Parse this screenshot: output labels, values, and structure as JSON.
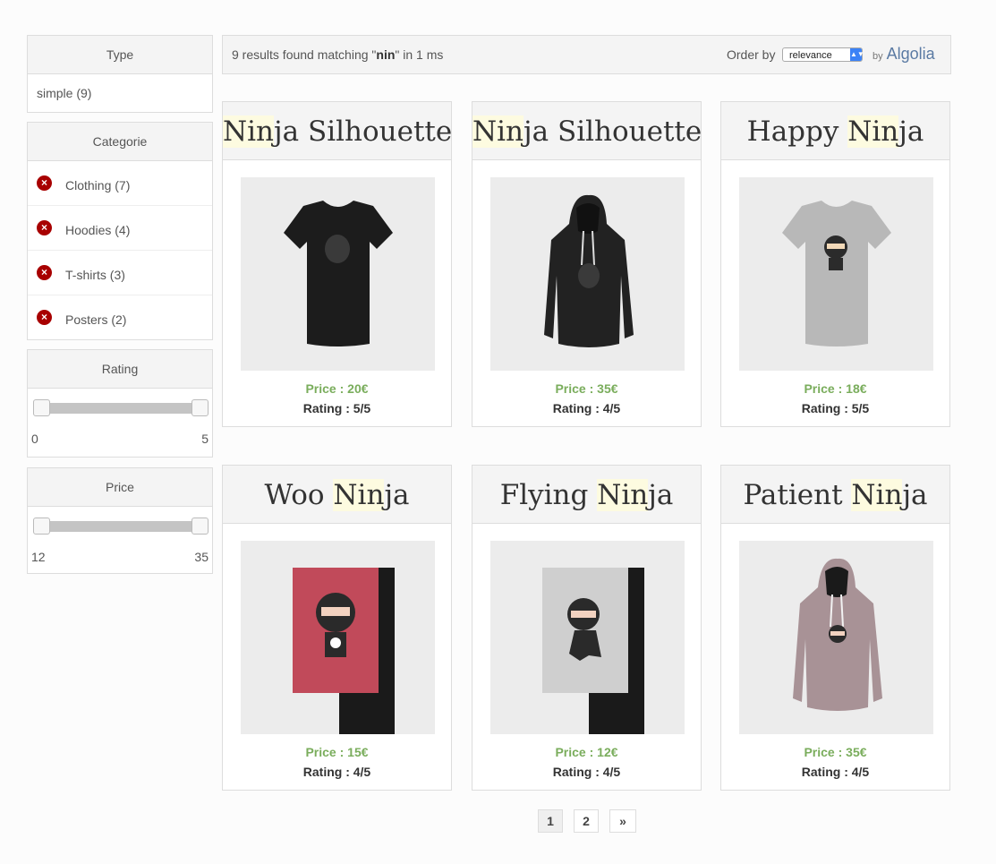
{
  "facets": {
    "type": {
      "title": "Type",
      "items": [
        {
          "label": "simple (9)"
        }
      ]
    },
    "categorie": {
      "title": "Categorie",
      "items": [
        {
          "label": "Clothing (7)"
        },
        {
          "label": "Hoodies (4)"
        },
        {
          "label": "T-shirts (3)"
        },
        {
          "label": "Posters (2)"
        }
      ]
    },
    "rating": {
      "title": "Rating",
      "min": "0",
      "max": "5"
    },
    "price": {
      "title": "Price",
      "min": "12",
      "max": "35"
    }
  },
  "results": {
    "prefix": "9 results found matching \"",
    "query": "nin",
    "suffix": "\" in 1 ms",
    "order_by_label": "Order by",
    "order_by_value": "relevance",
    "by_label": "by",
    "brand": "Algolia"
  },
  "products": [
    {
      "title_hl": "Nin",
      "title_rest": "ja Silhouette",
      "title_pre": "",
      "price": "Price : 20€",
      "rating": "Rating : 5/5",
      "image": "black-tshirt"
    },
    {
      "title_hl": "Nin",
      "title_rest": "ja Silhouette",
      "title_pre": "",
      "price": "Price : 35€",
      "rating": "Rating : 4/5",
      "image": "black-hoodie"
    },
    {
      "title_pre": "Happy ",
      "title_hl": "Nin",
      "title_rest": "ja",
      "price": "Price : 18€",
      "rating": "Rating : 5/5",
      "image": "grey-tshirt"
    },
    {
      "title_pre": "Woo ",
      "title_hl": "Nin",
      "title_rest": "ja",
      "price": "Price : 15€",
      "rating": "Rating : 4/5",
      "image": "red-poster"
    },
    {
      "title_pre": "Flying ",
      "title_hl": "Nin",
      "title_rest": "ja",
      "price": "Price : 12€",
      "rating": "Rating : 4/5",
      "image": "grey-poster"
    },
    {
      "title_pre": "Patient ",
      "title_hl": "Nin",
      "title_rest": "ja",
      "price": "Price : 35€",
      "rating": "Rating : 4/5",
      "image": "mauve-hoodie"
    }
  ],
  "pagination": {
    "pages": [
      "1",
      "2"
    ],
    "next": "»"
  },
  "colors": {
    "price_green": "#7aad5c",
    "remove_red": "#a80000",
    "highlight": "#fdfbe0"
  }
}
